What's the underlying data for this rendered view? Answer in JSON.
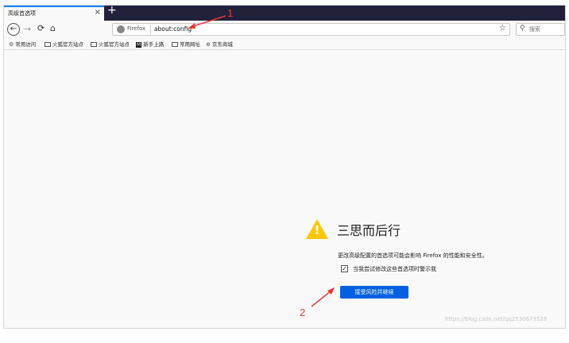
{
  "tab": {
    "title": "高级首选项",
    "close": "×",
    "new_tab": "+"
  },
  "nav": {
    "back": "←",
    "forward": "→",
    "reload": "⟳",
    "home": "⌂"
  },
  "urlbar": {
    "identity": "Firefox",
    "url": "about:config",
    "star": "☆"
  },
  "search": {
    "icon": "⚲",
    "placeholder": "搜索"
  },
  "bookmarks": [
    {
      "icon": "gear-icon",
      "label": "常用访问"
    },
    {
      "icon": "folder-icon",
      "label": "火狐官方站点"
    },
    {
      "icon": "folder-icon",
      "label": "火狐官方站点"
    },
    {
      "icon": "m-icon",
      "label": "新手上路"
    },
    {
      "icon": "folder-icon",
      "label": "常用网址"
    },
    {
      "icon": "globe-icon",
      "label": "京东商城"
    }
  ],
  "warning": {
    "title": "三思而后行",
    "description": "更改高级配置的首选项可能会影响 Firefox 的性能和安全性。",
    "checkbox_label": "当我尝试修改这些首选项时警示我",
    "checkbox_mark": "✓",
    "button_label": "接受风险并继续"
  },
  "annotations": {
    "one": "1",
    "two": "2"
  },
  "watermark": "https://blog.csdn.net/qq2530679528",
  "colors": {
    "accent": "#0060df",
    "warning": "#ffc700",
    "annotation": "#e53935",
    "tabstrip": "#20213a"
  }
}
